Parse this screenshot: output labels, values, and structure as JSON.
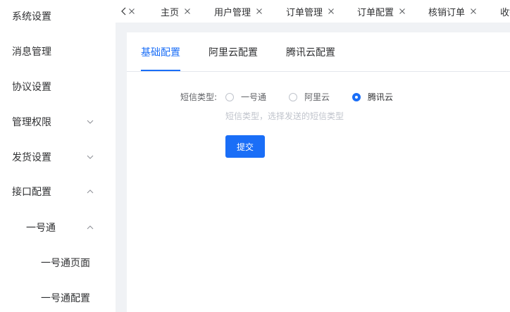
{
  "sidebar": {
    "items": [
      {
        "label": "系统设置"
      },
      {
        "label": "消息管理"
      },
      {
        "label": "协议设置"
      },
      {
        "label": "管理权限"
      },
      {
        "label": "发货设置"
      },
      {
        "label": "接口配置"
      },
      {
        "label": "一号通"
      },
      {
        "label": "一号通页面"
      },
      {
        "label": "一号通配置"
      }
    ]
  },
  "tabs": [
    {
      "label": "主页"
    },
    {
      "label": "用户管理"
    },
    {
      "label": "订单管理"
    },
    {
      "label": "订单配置"
    },
    {
      "label": "核销订单"
    },
    {
      "label": "收银"
    }
  ],
  "config": {
    "subtabs": [
      {
        "label": "基础配置"
      },
      {
        "label": "阿里云配置"
      },
      {
        "label": "腾讯云配置"
      }
    ],
    "active_subtab": "基础配置",
    "sms_type_label": "短信类型:",
    "options": [
      {
        "label": "一号通"
      },
      {
        "label": "阿里云"
      },
      {
        "label": "腾讯云"
      }
    ],
    "selected_option": "腾讯云",
    "hint": "短信类型，选择发送的短信类型",
    "submit_label": "提交"
  },
  "colors": {
    "accent": "#1a6ef7",
    "background": "#f0f2f5"
  }
}
